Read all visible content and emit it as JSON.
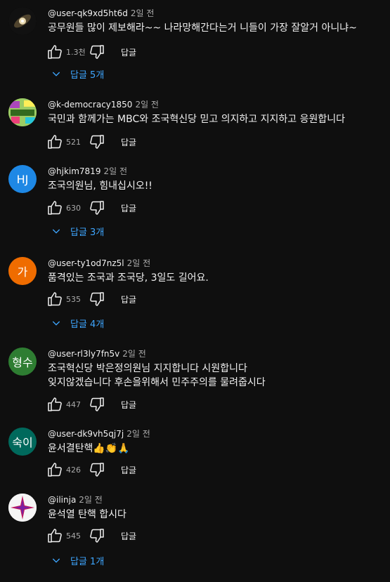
{
  "comments": [
    {
      "author": "@user-qk9xd5ht6d",
      "time": "2일 전",
      "text": "공무원들 많이 제보해라~~ 나라망해간다는거 니들이 가장 잘알거 아니냐~",
      "likes": "1.3천",
      "reply_label": "답글",
      "replies": "답글 5개",
      "avatar": {
        "type": "image",
        "desc": "galaxy"
      }
    },
    {
      "author": "@k-democracy1850",
      "time": "2일 전",
      "text": "국민과 함께가는 MBC와 조국혁신당 믿고 의지하고 지지하고 응원합니다",
      "likes": "521",
      "reply_label": "답글",
      "avatar": {
        "type": "image",
        "desc": "k-democracy logo"
      }
    },
    {
      "author": "@hjkim7819",
      "time": "2일 전",
      "text": "조국의원님, 힘내십시오!!",
      "likes": "630",
      "reply_label": "답글",
      "replies": "답글 3개",
      "avatar": {
        "type": "initials",
        "initials": "HJ",
        "color": "#1e88e5"
      }
    },
    {
      "author": "@user-ty1od7nz5l",
      "time": "2일 전",
      "text": "품격있는 조국과 조국당, 3일도 길어요.",
      "likes": "535",
      "reply_label": "답글",
      "replies": "답글 4개",
      "avatar": {
        "type": "initials",
        "initials": "가",
        "color": "#ef6c00"
      }
    },
    {
      "author": "@user-rl3ly7fn5v",
      "time": "2일 전",
      "text_lines": [
        "조국혁신당 박은정의원님 지지합니다 시원합니다",
        "잊지않겠습니다 후손을위해서 민주주의를 물려줍시다"
      ],
      "likes": "447",
      "reply_label": "답글",
      "avatar": {
        "type": "initials",
        "initials": "형수",
        "color": "#2e7d32"
      }
    },
    {
      "author": "@user-dk9vh5qj7j",
      "time": "2일 전",
      "text": "윤서결탄핵👍👏🙏",
      "likes": "426",
      "reply_label": "답글",
      "avatar": {
        "type": "initials",
        "initials": "숙이",
        "color": "#00695c"
      }
    },
    {
      "author": "@ilinja",
      "time": "2일 전",
      "text": "윤석열 탄핵 합시다",
      "likes": "545",
      "reply_label": "답글",
      "replies": "답글 1개",
      "avatar": {
        "type": "image",
        "desc": "star logo"
      }
    }
  ],
  "colors": {
    "background": "#0f0f0f",
    "link": "#3ea6ff",
    "muted": "#aaaaaa"
  },
  "icons": [
    "thumb-up-icon",
    "thumb-down-icon",
    "chevron-down-icon"
  ]
}
